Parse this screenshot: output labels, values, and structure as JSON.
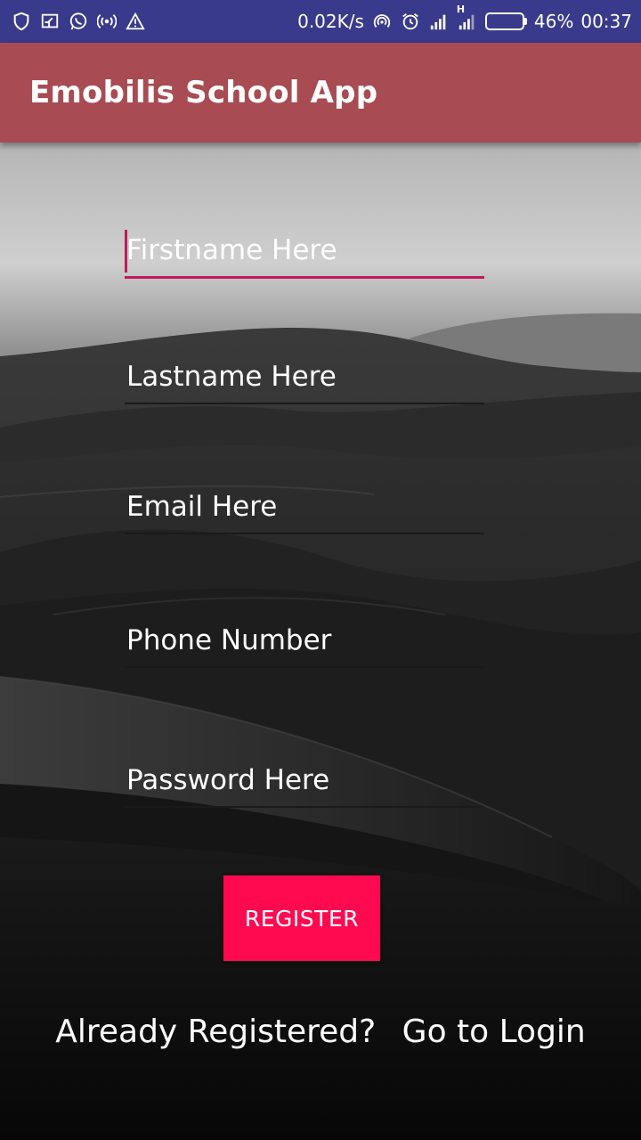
{
  "status_bar": {
    "left_icons": [
      "shield-icon",
      "cast-icon",
      "whatsapp-icon",
      "hotspot-icon",
      "warning-icon"
    ],
    "net_speed": "0.02K/s",
    "battery_percent_text": "46%",
    "battery_level": 0.46,
    "time": "00:37",
    "network_label": "H"
  },
  "app_bar": {
    "title": "Emobilis School App",
    "color": "#a84b53"
  },
  "form": {
    "firstname_placeholder": "Firstname Here",
    "lastname_placeholder": "Lastname Here",
    "email_placeholder": "Email Here",
    "phone_placeholder": "Phone Number",
    "password_placeholder": "Password Here",
    "focused_field": "firstname",
    "accent_color": "#c2185b"
  },
  "register_button": {
    "label": "REGISTER",
    "color": "#ff0a50"
  },
  "footer": {
    "question": "Already Registered?",
    "link": "Go to Login"
  }
}
